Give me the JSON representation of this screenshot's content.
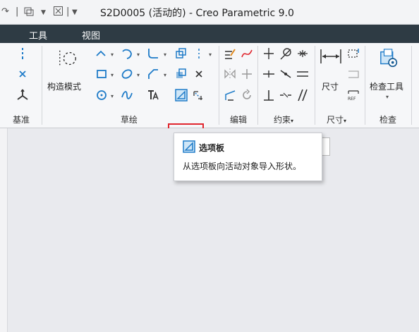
{
  "titlebar": {
    "title": "S2D0005 (活动的) - Creo Parametric 9.0",
    "qa_items": [
      "redo-icon",
      "window-icon",
      "close-window-icon",
      "customize-icon"
    ]
  },
  "menubar": {
    "items": [
      "工具",
      "视图"
    ]
  },
  "ribbon": {
    "groups": {
      "datum": "基准",
      "sketch": "草绘",
      "edit": "编辑",
      "constrain": "约束",
      "dimension": "尺寸",
      "inspect": "检查"
    },
    "buttons": {
      "construction_mode": "构造模式",
      "dimension": "尺寸",
      "inspect_tools": "检查工具"
    },
    "dropdown_arrow": "▾"
  },
  "tooltip": {
    "title": "选项板",
    "description": "从选项板向活动对象导入形状。"
  },
  "colors": {
    "menubar": "#2e3b44",
    "highlight": "#e0262e",
    "icon_blue": "#1e7bc8"
  }
}
